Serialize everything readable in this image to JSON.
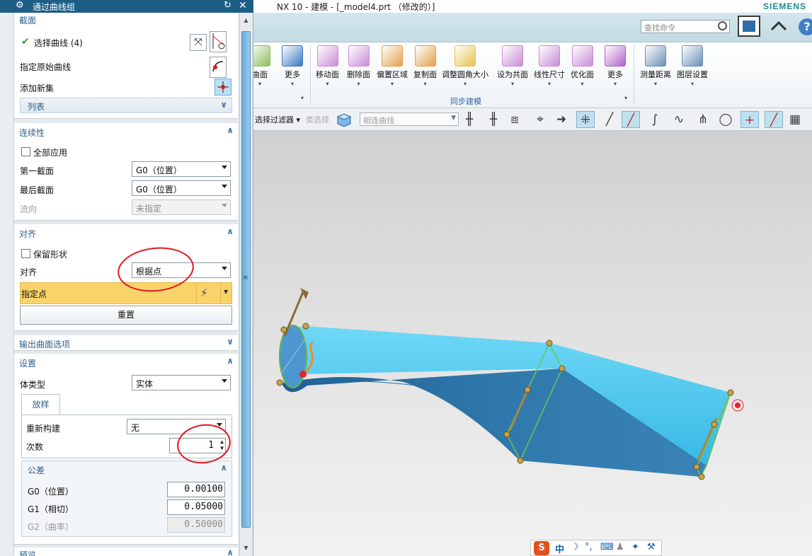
{
  "app": {
    "title": "NX 10 - 建模 - [_model4.prt （修改的）]",
    "brand": "SIEMENS",
    "command_search_placeholder": "查找命令",
    "help_label": "?"
  },
  "ribbon": {
    "buttons": [
      {
        "label": "曲面",
        "icon": "surface-icon",
        "color": "#8bbf5a"
      },
      {
        "label": "更多",
        "icon": "more-icon",
        "color": "#3b78c5"
      },
      {
        "label": "移动面",
        "icon": "move-face-icon",
        "color": "#c98bd6"
      },
      {
        "label": "删除面",
        "icon": "delete-face-icon",
        "color": "#c98bd6"
      },
      {
        "label": "偏置区域",
        "icon": "offset-region-icon",
        "color": "#e3a248"
      },
      {
        "label": "复制面",
        "icon": "copy-face-icon",
        "color": "#e3a248"
      },
      {
        "label": "调整圆角大小",
        "icon": "resize-blend-icon",
        "color": "#e6c24a"
      },
      {
        "label": "设为共面",
        "icon": "make-coplanar-icon",
        "color": "#c98bd6"
      },
      {
        "label": "线性尺寸",
        "icon": "linear-dimension-icon",
        "color": "#c98bd6"
      },
      {
        "label": "优化面",
        "icon": "optimize-face-icon",
        "color": "#c98bd6"
      },
      {
        "label": "更多",
        "icon": "more-sync-icon",
        "color": "#b061c8"
      },
      {
        "label": "测量距离",
        "icon": "measure-distance-icon",
        "color": "#6a8fb3"
      },
      {
        "label": "图层设置",
        "icon": "layer-settings-icon",
        "color": "#6a8fb3"
      }
    ],
    "group_label": "同步建模"
  },
  "selection_bar": {
    "filter_label": "选择过滤器",
    "type_label": "类选择",
    "curve_rule_value": "相连曲线",
    "tools": [
      {
        "name": "snap-point-icon",
        "glyph": "⁜",
        "on": true
      },
      {
        "name": "line-snap-icon",
        "glyph": "╱",
        "on": false
      },
      {
        "name": "end-point-icon",
        "glyph": "╱",
        "on": true
      },
      {
        "name": "curve-icon",
        "glyph": "∫",
        "on": false
      },
      {
        "name": "mid-point-icon",
        "glyph": "∿",
        "on": false
      },
      {
        "name": "control-point-icon",
        "glyph": "⋔",
        "on": false
      },
      {
        "name": "arc-center-icon",
        "glyph": "◯",
        "on": false
      },
      {
        "name": "intersection-icon",
        "glyph": "+",
        "on": true
      },
      {
        "name": "quadrant-icon",
        "glyph": "╱",
        "on": true
      },
      {
        "name": "grid-icon",
        "glyph": "▦",
        "on": false
      }
    ]
  },
  "dialog": {
    "title": "通过曲线组",
    "section_section": {
      "header": "截面",
      "select_curve_label": "选择曲线 (4)",
      "origin_curve_label": "指定原始曲线",
      "add_set_label": "添加新集",
      "list_label": "列表"
    },
    "continuity": {
      "header": "连续性",
      "apply_all_label": "全部应用",
      "first_section_label": "第一截面",
      "first_section_value": "G0（位置）",
      "last_section_label": "最后截面",
      "last_section_value": "G0（位置）",
      "flow_label": "流向",
      "flow_value": "未指定"
    },
    "alignment": {
      "header": "对齐",
      "keep_shape_label": "保留形状",
      "align_label": "对齐",
      "align_value": "根据点",
      "specify_point_label": "指定点",
      "reset_label": "重置"
    },
    "output_options": {
      "header": "输出曲面选项"
    },
    "settings": {
      "header": "设置",
      "body_type_label": "体类型",
      "body_type_value": "实体",
      "tab_label": "放样",
      "rebuild_label": "重新构建",
      "rebuild_value": "无",
      "degree_label": "次数",
      "degree_value": "1",
      "tolerance_header": "公差",
      "g0_label": "G0（位置）",
      "g0_value": "0.00100",
      "g1_label": "G1（相切）",
      "g1_value": "0.05000",
      "g2_label": "G2（曲率）",
      "g2_value": "0.50000"
    },
    "preview": {
      "header": "预览"
    }
  },
  "ime": {
    "logo": "S",
    "mode": "中"
  }
}
